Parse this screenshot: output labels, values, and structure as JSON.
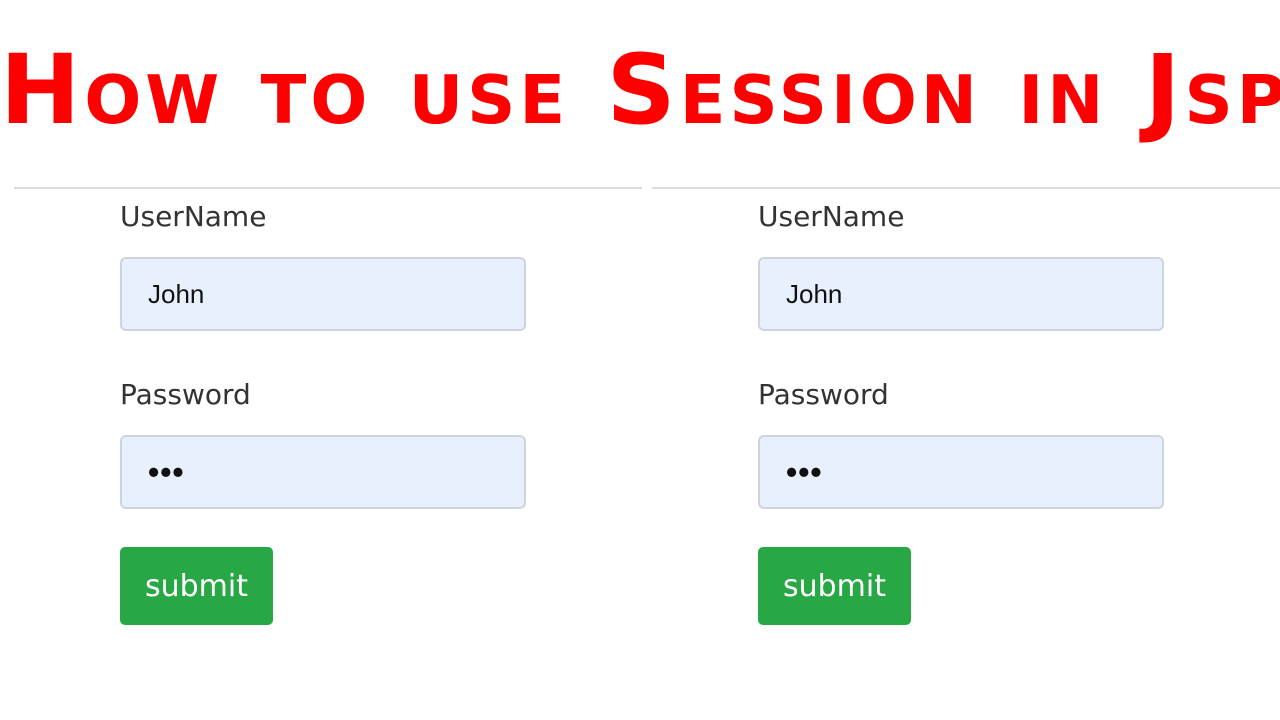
{
  "title": "How to use Session in Jsp",
  "forms": [
    {
      "username_label": "UserName",
      "username_value": "John",
      "password_label": "Password",
      "password_value": "•••",
      "submit_label": "submit"
    },
    {
      "username_label": "UserName",
      "username_value": "John",
      "password_label": "Password",
      "password_value": "•••",
      "submit_label": "submit"
    }
  ],
  "colors": {
    "title": "#ff0000",
    "submit_button": "#28a745",
    "input_background": "#e8f0fe"
  }
}
